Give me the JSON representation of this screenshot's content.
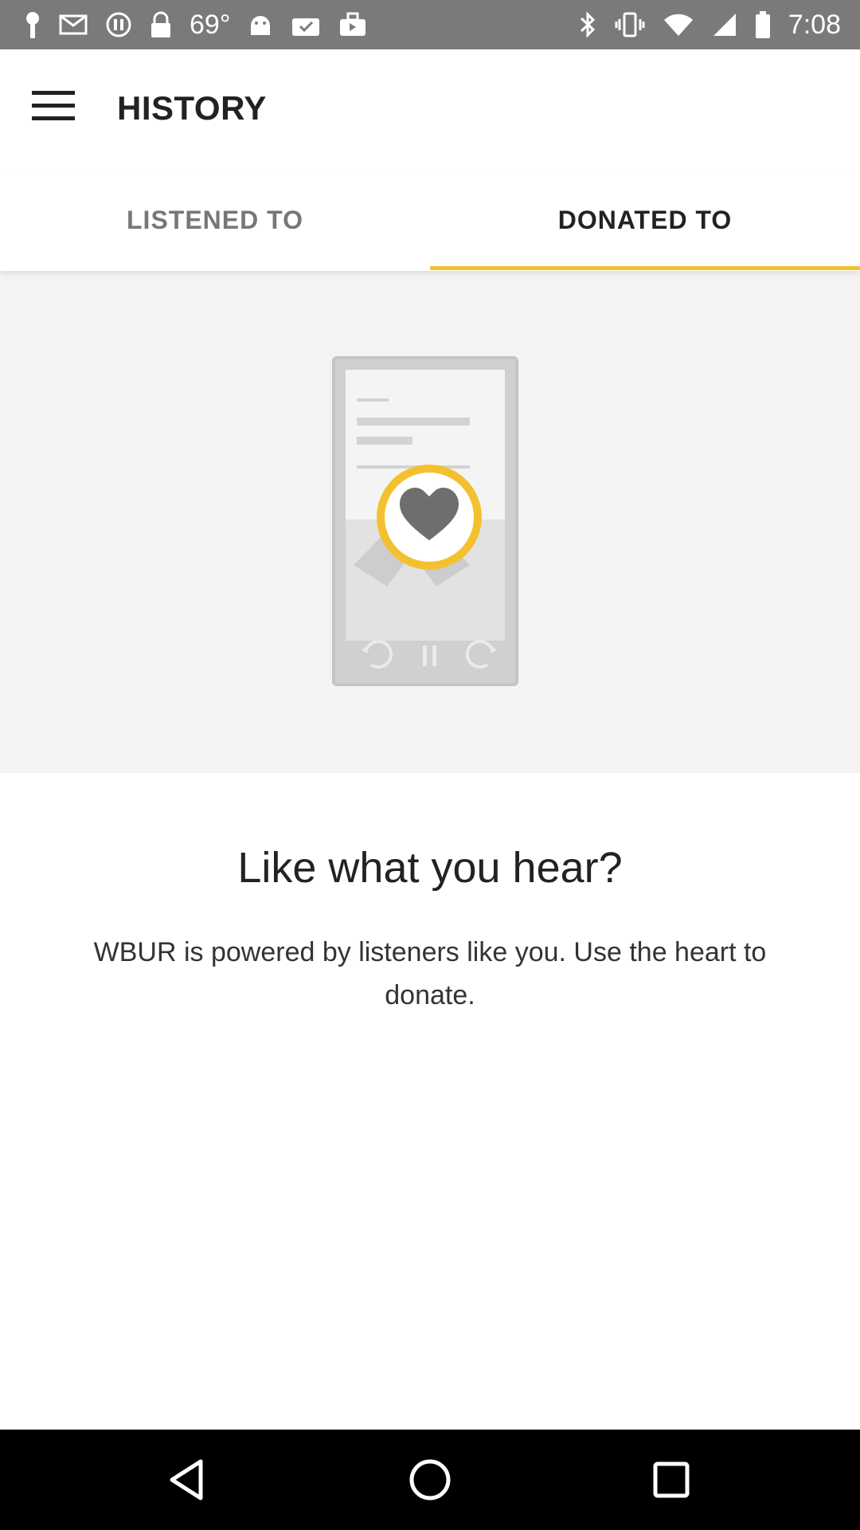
{
  "status_bar": {
    "temperature": "69°",
    "time": "7:08",
    "left_icons": [
      "notification-icon",
      "mail-icon",
      "loading-icon",
      "lock-icon",
      "temperature-text",
      "android-icon",
      "check-bag-icon",
      "briefcase-icon"
    ],
    "right_icons": [
      "bluetooth-icon",
      "vibrate-icon",
      "wifi-icon",
      "signal-icon",
      "battery-icon"
    ]
  },
  "app_bar": {
    "title": "HISTORY",
    "menu_icon": "hamburger-menu-icon"
  },
  "tabs": [
    {
      "label": "LISTENED TO",
      "selected": false
    },
    {
      "label": "DONATED TO",
      "selected": true
    }
  ],
  "colors": {
    "accent": "#f3c12f",
    "status_bar": "#7a7a7a",
    "hero_background": "#f3f3f3",
    "nav_bar": "#000000"
  },
  "empty_state": {
    "illustration": "phone-heart-illustration",
    "heading": "Like what you hear?",
    "body": "WBUR is powered by listeners like you. Use the heart to donate."
  },
  "nav_bar": {
    "buttons": [
      "back-icon",
      "home-icon",
      "recents-icon"
    ]
  }
}
